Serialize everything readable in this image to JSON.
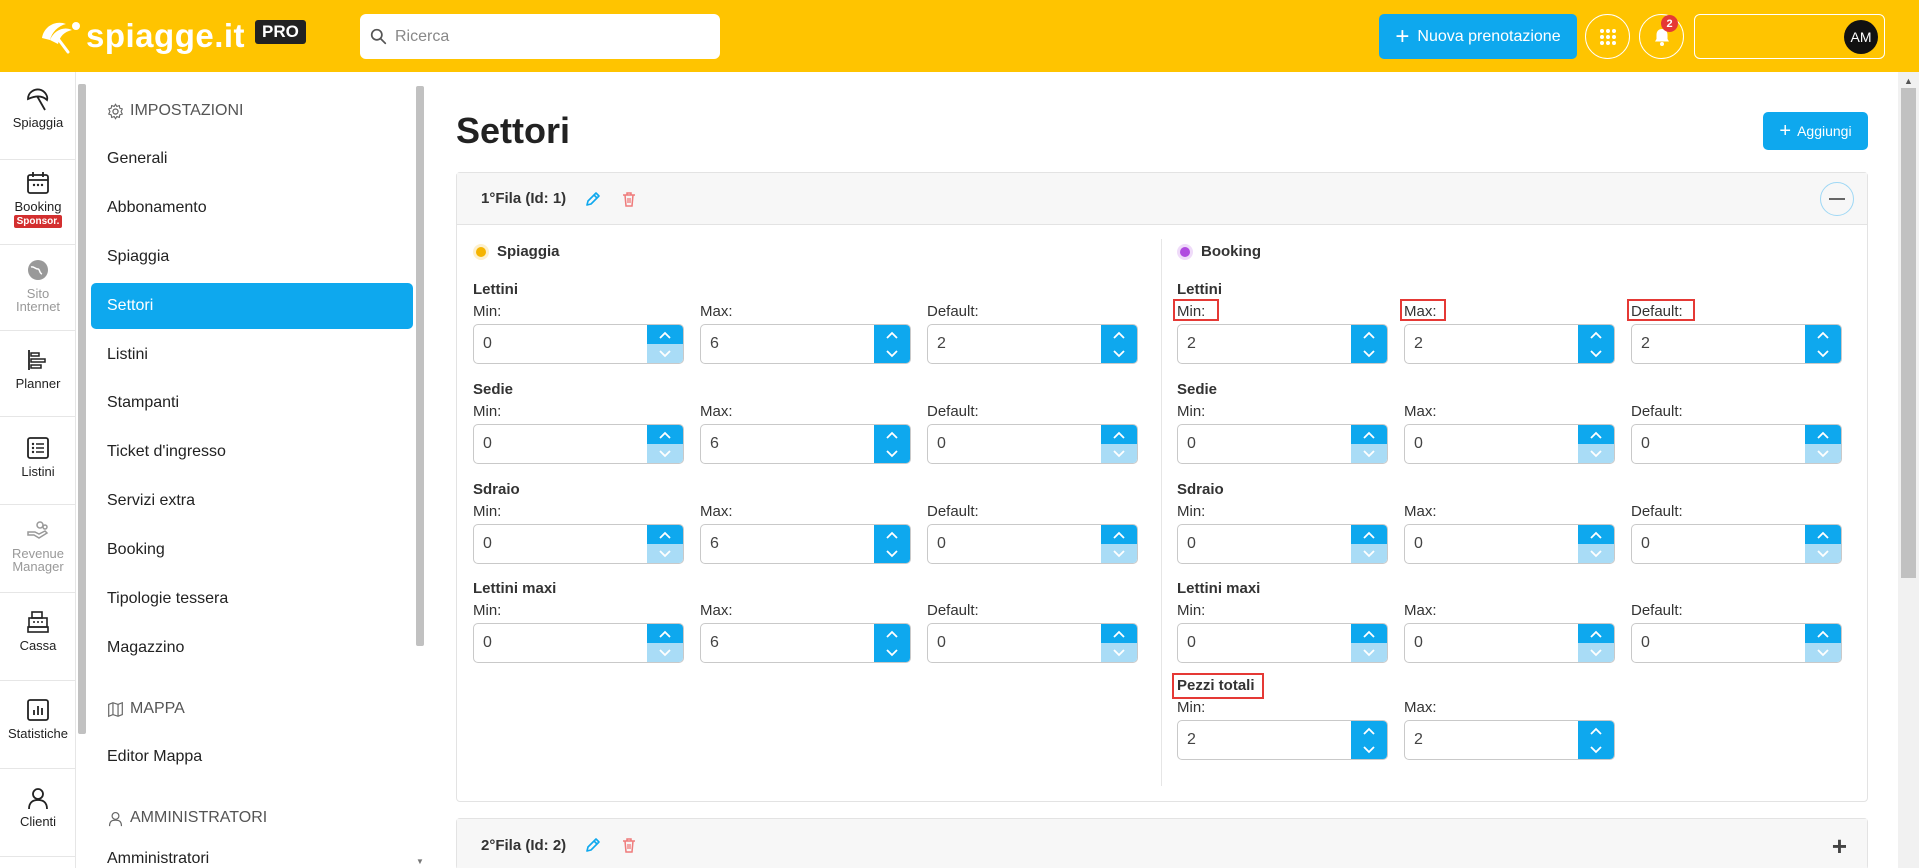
{
  "header": {
    "logo_text": "spiagge.it",
    "logo_badge": "PRO",
    "search_placeholder": "Ricerca",
    "new_booking_label": "Nuova prenotazione",
    "notifications_count": "2",
    "user_initials": "AM"
  },
  "iconnav": [
    {
      "label": "Spiaggia",
      "icon": "umbrella-icon",
      "disabled": false
    },
    {
      "label": "Booking",
      "icon": "calendar-icon",
      "disabled": false,
      "badge": "Sponsor."
    },
    {
      "label": "Sito Internet",
      "icon": "globe-icon",
      "disabled": true
    },
    {
      "label": "Planner",
      "icon": "planner-icon",
      "disabled": false
    },
    {
      "label": "Listini",
      "icon": "list-icon",
      "disabled": false
    },
    {
      "label": "Revenue Manager",
      "icon": "revenue-icon",
      "disabled": true
    },
    {
      "label": "Cassa",
      "icon": "cash-register-icon",
      "disabled": false
    },
    {
      "label": "Statistiche",
      "icon": "chart-icon",
      "disabled": false
    },
    {
      "label": "Clienti",
      "icon": "user-icon",
      "disabled": false
    }
  ],
  "settings_menu": {
    "sections": [
      {
        "title": "IMPOSTAZIONI",
        "items": [
          "Generali",
          "Abbonamento",
          "Spiaggia",
          "Settori",
          "Listini",
          "Stampanti",
          "Ticket d'ingresso",
          "Servizi extra",
          "Booking",
          "Tipologie tessera",
          "Magazzino"
        ]
      },
      {
        "title": "MAPPA",
        "items": [
          "Editor Mappa"
        ]
      },
      {
        "title": "AMMINISTRATORI",
        "items": [
          "Amministratori"
        ]
      }
    ],
    "active": "Settori"
  },
  "page": {
    "title": "Settori",
    "add_button": "Aggiungi"
  },
  "sectors": [
    {
      "title": "1°Fila (Id: 1)",
      "expanded": true,
      "spiaggia": {
        "title": "Spiaggia",
        "color": "#f5b400",
        "groups": [
          {
            "name": "Lettini",
            "min": "0",
            "max": "6",
            "default": "2"
          },
          {
            "name": "Sedie",
            "min": "0",
            "max": "6",
            "default": "0"
          },
          {
            "name": "Sdraio",
            "min": "0",
            "max": "6",
            "default": "0"
          },
          {
            "name": "Lettini maxi",
            "min": "0",
            "max": "6",
            "default": "0"
          }
        ]
      },
      "booking": {
        "title": "Booking",
        "color": "#b04be0",
        "groups": [
          {
            "name": "Lettini",
            "min": "2",
            "max": "2",
            "default": "2"
          },
          {
            "name": "Sedie",
            "min": "0",
            "max": "0",
            "default": "0"
          },
          {
            "name": "Sdraio",
            "min": "0",
            "max": "0",
            "default": "0"
          },
          {
            "name": "Lettini maxi",
            "min": "0",
            "max": "0",
            "default": "0"
          }
        ],
        "totals": {
          "name": "Pezzi totali",
          "min": "2",
          "max": "2"
        }
      }
    },
    {
      "title": "2°Fila (Id: 2)",
      "expanded": false
    }
  ],
  "labels": {
    "min": "Min:",
    "max": "Max:",
    "default": "Default:"
  },
  "colors": {
    "topbar": "#ffc400",
    "accent": "#0ea8ee",
    "highlight": "#e53935"
  }
}
